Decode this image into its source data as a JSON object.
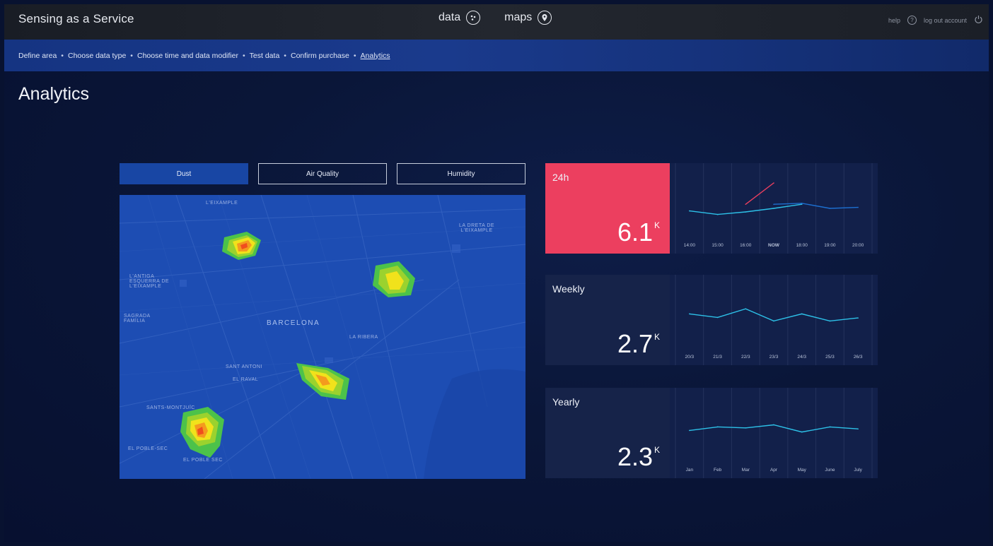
{
  "header": {
    "app_title": "Sensing as a Service",
    "nav": [
      {
        "label": "data",
        "icon": "data-dots-icon"
      },
      {
        "label": "maps",
        "icon": "map-pin-icon"
      }
    ],
    "help_label": "help",
    "logout_label": "log out account"
  },
  "breadcrumb": {
    "items": [
      "Define area",
      "Choose data type",
      "Choose time and data modifier",
      "Test data",
      "Confirm purchase",
      "Analytics"
    ],
    "separator": "•",
    "active_index": 5
  },
  "page": {
    "title": "Analytics"
  },
  "tabs": [
    {
      "label": "Dust",
      "active": true
    },
    {
      "label": "Air Quality",
      "active": false
    },
    {
      "label": "Humidity",
      "active": false
    }
  ],
  "map": {
    "city_label": "Barcelona",
    "labels": [
      "L'Eixample",
      "La Dreta de l'Eixample",
      "L'Antiga Esquerra de l'Eixample",
      "Sagrada Família",
      "El Poble-sec",
      "La Ribera",
      "Sant Antoni",
      "Sants-Montjuïc",
      "El Raval",
      "El Poble Sec"
    ],
    "heat_colors": [
      "#4cc24a",
      "#9bd22e",
      "#f1e21b",
      "#f49a1e",
      "#f04e1e"
    ]
  },
  "stats": [
    {
      "label": "24h",
      "value": "6.1",
      "unit": "K",
      "color": "#ec3f5f",
      "chart_data": {
        "type": "line",
        "x": [
          "14:00",
          "15:00",
          "16:00",
          "NOW",
          "18:00",
          "19:00",
          "20:00"
        ],
        "series": [
          {
            "values": [
              0.45,
              0.38,
              0.43,
              0.5,
              0.58,
              null,
              null
            ],
            "color": "#2dc1e8"
          },
          {
            "values": [
              null,
              null,
              null,
              0.58,
              0.6,
              0.5,
              0.52
            ],
            "color": "#1d6fd0"
          },
          {
            "values": [
              null,
              null,
              0.58,
              1.0,
              null,
              null,
              null
            ],
            "color": "#ec3f5f"
          }
        ],
        "highlight_label": "NOW"
      }
    },
    {
      "label": "Weekly",
      "value": "2.7",
      "unit": "K",
      "color": "#162349",
      "chart_data": {
        "type": "line",
        "x": [
          "20/3",
          "21/3",
          "22/3",
          "23/3",
          "24/3",
          "25/3",
          "26/3"
        ],
        "series": [
          {
            "values": [
              0.62,
              0.55,
              0.72,
              0.48,
              0.62,
              0.48,
              0.54
            ],
            "color": "#2dc1e8"
          }
        ]
      }
    },
    {
      "label": "Yearly",
      "value": "2.3",
      "unit": "K",
      "color": "#162349",
      "chart_data": {
        "type": "line",
        "x": [
          "Jan",
          "Feb",
          "Mar",
          "Apr",
          "May",
          "June",
          "July"
        ],
        "series": [
          {
            "values": [
              0.55,
              0.62,
              0.6,
              0.66,
              0.52,
              0.62,
              0.58
            ],
            "color": "#2dc1e8"
          }
        ]
      }
    }
  ]
}
